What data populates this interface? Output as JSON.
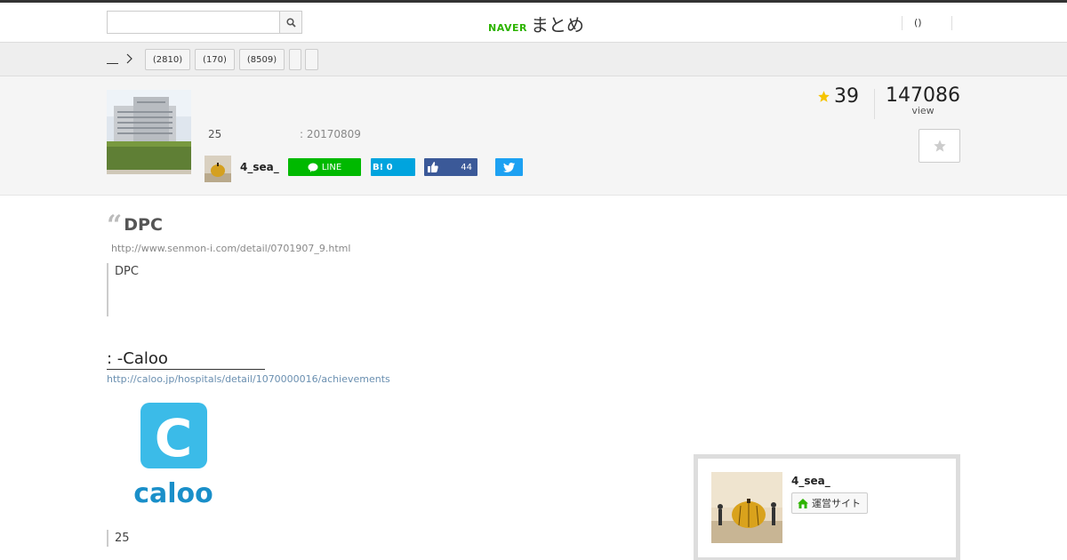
{
  "header": {
    "search_placeholder": "",
    "logo_naver": "NAVER",
    "logo_matome": "まとめ",
    "right_text": "()"
  },
  "category_bar": {
    "tags": [
      "(2810)",
      "(170)",
      "(8509)",
      "",
      ""
    ]
  },
  "info": {
    "meta_count": "25",
    "meta_date": ": 20170809",
    "author": "4_sea_",
    "share": {
      "line_label": "LINE",
      "hatena_label": "B! 0",
      "fb_count": "44"
    },
    "favorites": "39",
    "views": "147086",
    "views_label": "view"
  },
  "content": {
    "quote_title": "DPC",
    "quote_source": "http://www.senmon-i.com/detail/0701907_9.html",
    "quote_body": "DPC",
    "link_title": ":  -Caloo",
    "link_url": "http://caloo.jp/hospitals/detail/1070000016/achievements",
    "caloo_logo_text": "caloo",
    "caloo_logo_letter": "C",
    "note": "25"
  },
  "author_card": {
    "name": "4_sea_",
    "site_button": "運営サイト"
  },
  "colors": {
    "naver_green": "#2db400",
    "line_green": "#00b900",
    "hatena_blue": "#00a4de",
    "facebook_blue": "#3b5998",
    "twitter_blue": "#1da1f2",
    "star_yellow": "#f5c400",
    "caloo_blue": "#3bbbe8"
  }
}
